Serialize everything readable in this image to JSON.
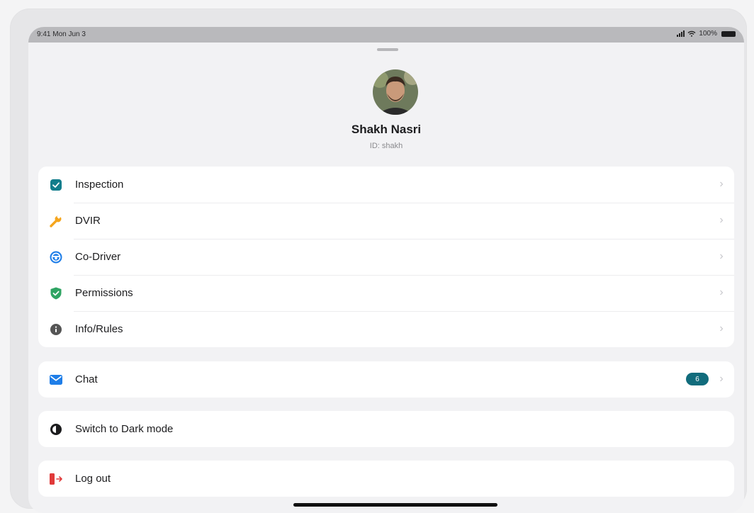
{
  "status_bar": {
    "time": "9:41 Mon Jun 3",
    "battery": "100%"
  },
  "profile": {
    "name": "Shakh Nasri",
    "id_text": "ID: shakh"
  },
  "menu_main": [
    {
      "label": "Inspection",
      "icon": "checkbox-icon",
      "color": "#127d8c"
    },
    {
      "label": "DVIR",
      "icon": "wrench-icon",
      "color": "#f5a51d"
    },
    {
      "label": "Co-Driver",
      "icon": "steering-wheel-icon",
      "color": "#1f7ee8"
    },
    {
      "label": "Permissions",
      "icon": "shield-check-icon",
      "color": "#2fa463"
    },
    {
      "label": "Info/Rules",
      "icon": "info-icon",
      "color": "#555555"
    }
  ],
  "chat": {
    "label": "Chat",
    "badge": "6",
    "icon": "envelope-icon",
    "color": "#1f7ee8",
    "badge_color": "#116c7c"
  },
  "dark_mode": {
    "label": "Switch to Dark mode",
    "icon": "half-moon-icon"
  },
  "logout": {
    "label": "Log out",
    "icon": "logout-icon",
    "color": "#e03a3a"
  }
}
